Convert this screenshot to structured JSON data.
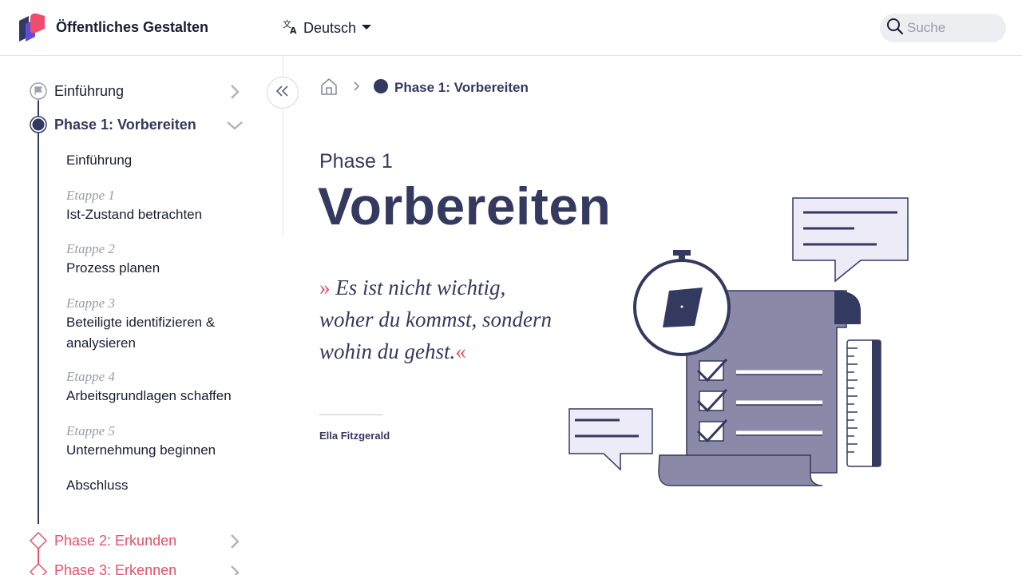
{
  "header": {
    "brand": "Öffentliches Gestalten",
    "language": "Deutsch",
    "search_placeholder": "Suche"
  },
  "sidebar": {
    "intro": "Einführung",
    "phase1": {
      "label": "Phase 1: Vorbereiten",
      "items": [
        {
          "kicker": "",
          "label": "Einführung"
        },
        {
          "kicker": "Etappe 1",
          "label": "Ist-Zustand betrachten"
        },
        {
          "kicker": "Etappe 2",
          "label": "Prozess planen"
        },
        {
          "kicker": "Etappe 3",
          "label": "Beteiligte identifizieren & analysieren"
        },
        {
          "kicker": "Etappe 4",
          "label": "Arbeitsgrundlagen schaffen"
        },
        {
          "kicker": "Etappe 5",
          "label": "Unternehmung beginnen"
        },
        {
          "kicker": "",
          "label": "Abschluss"
        }
      ]
    },
    "phase2": "Phase 2: Erkunden",
    "phase3": "Phase 3: Erkennen"
  },
  "breadcrumb": {
    "current": "Phase 1: Vorbereiten"
  },
  "main": {
    "kicker": "Phase 1",
    "title": "Vorbereiten",
    "quote_open": "»",
    "quote_text": " Es ist nicht wichtig, woher du kommst, sondern wohin du gehst.",
    "quote_close": "«",
    "author": "Ella Fitzgerald"
  },
  "colors": {
    "navy": "#34395f",
    "accent_red": "#e8506e",
    "muted": "#9a9caa",
    "paper": "#8a8aa8",
    "bubble": "#ecebf7"
  }
}
